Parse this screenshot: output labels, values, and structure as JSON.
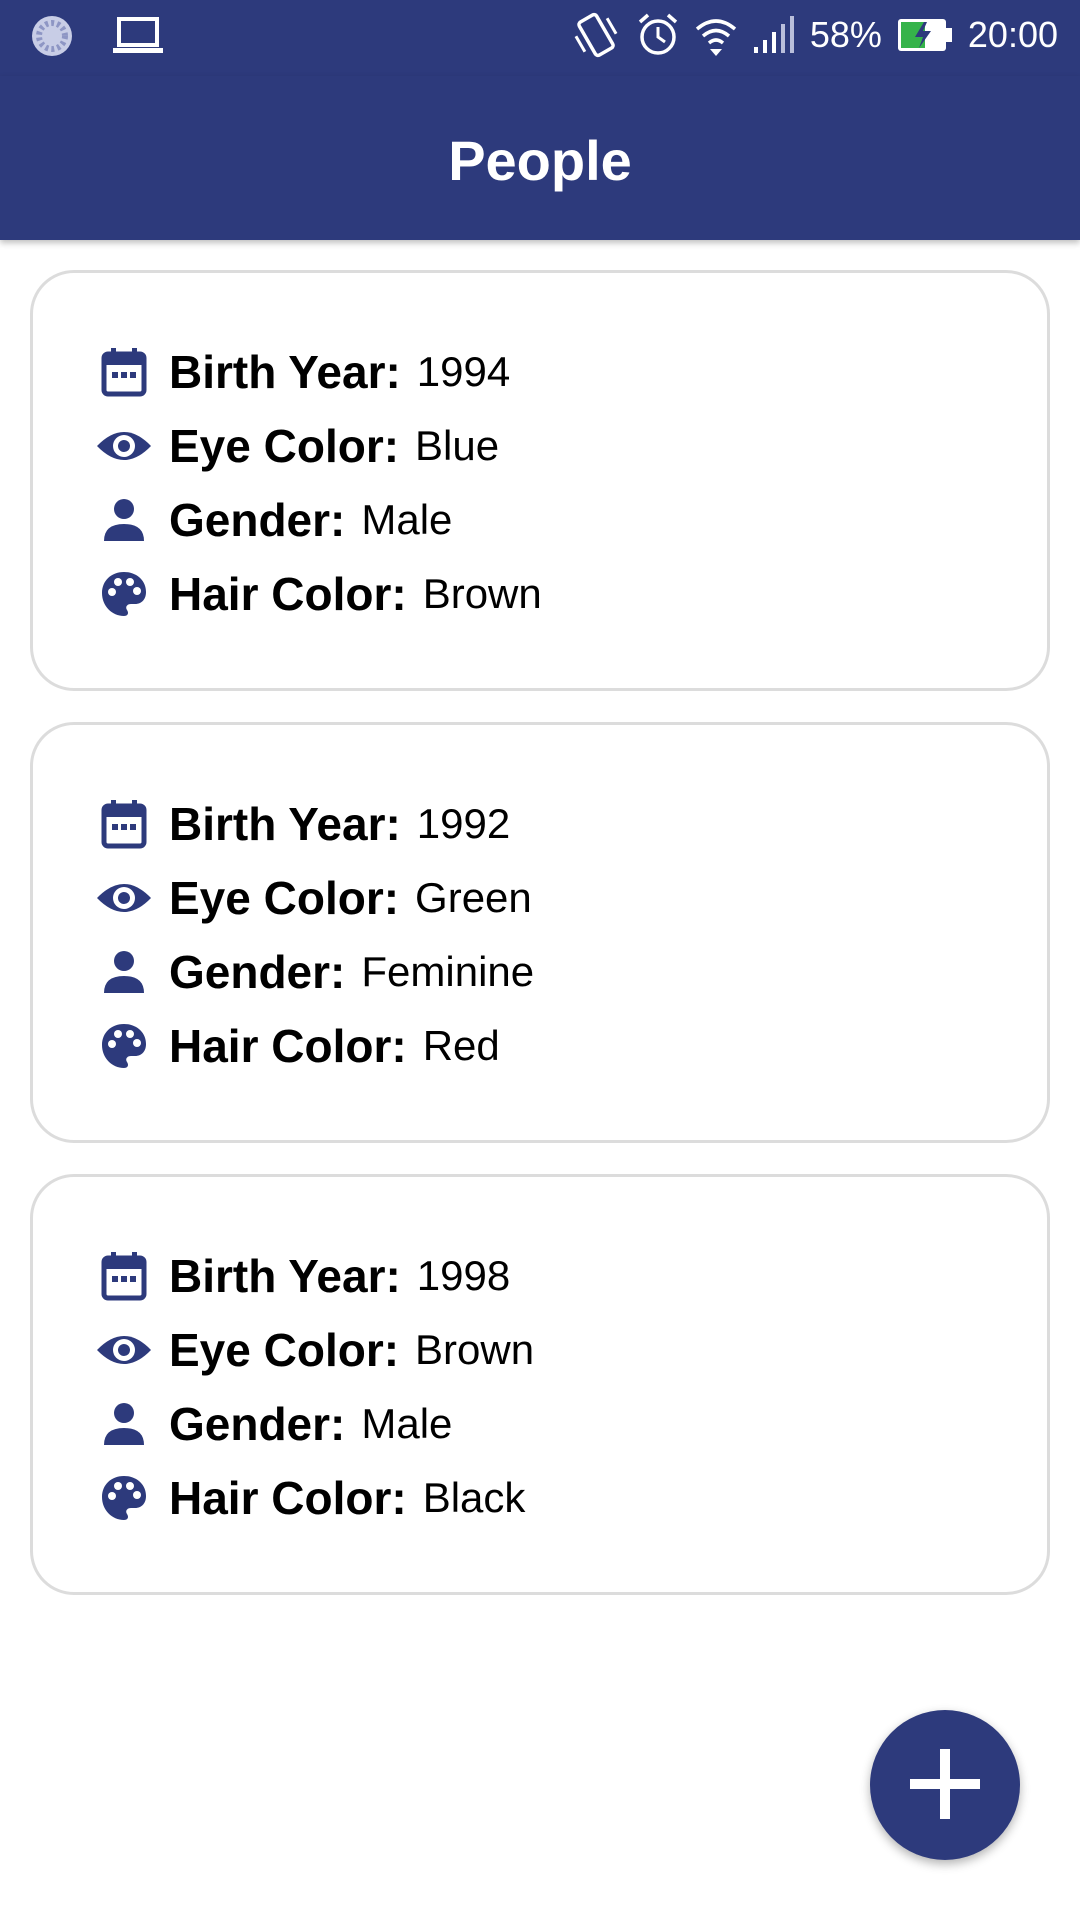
{
  "status_bar": {
    "battery_percent": "58%",
    "time": "20:00",
    "icons": [
      "app-indicator-icon",
      "laptop-icon",
      "vibrate-icon",
      "alarm-icon",
      "wifi-icon",
      "signal-icon",
      "battery-charging-icon"
    ]
  },
  "app_bar": {
    "title": "People"
  },
  "labels": {
    "birth_year": "Birth Year:",
    "eye_color": "Eye Color:",
    "gender": "Gender:",
    "hair_color": "Hair Color:"
  },
  "people": [
    {
      "birth_year": "1994",
      "eye_color": "Blue",
      "gender": "Male",
      "hair_color": "Brown"
    },
    {
      "birth_year": "1992",
      "eye_color": "Green",
      "gender": "Feminine",
      "hair_color": "Red"
    },
    {
      "birth_year": "1998",
      "eye_color": "Brown",
      "gender": "Male",
      "hair_color": "Black"
    }
  ],
  "fab": {
    "icon": "plus-icon"
  },
  "colors": {
    "primary": "#2d3a7c",
    "card_border": "#dcdcdc",
    "background": "#ffffff"
  }
}
